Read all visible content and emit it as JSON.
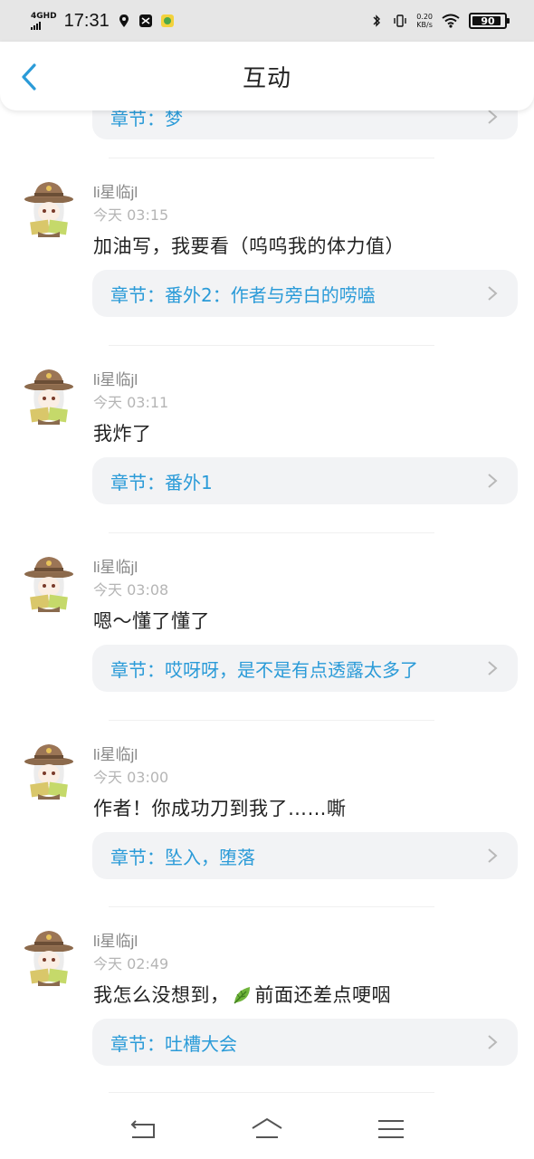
{
  "status_bar": {
    "network": "4GHD",
    "time": "17:31",
    "speed_value": "0.20",
    "speed_unit": "KB/s",
    "battery": "90",
    "battery_level": 0.9
  },
  "header": {
    "title": "互动"
  },
  "partial_chapter": {
    "label": "章节：梦"
  },
  "comments": [
    {
      "username": "li星临jl",
      "time": "今天 03:15",
      "text": "加油写，我要看（呜呜我的体力值）",
      "chapter": "章节：番外2：作者与旁白的唠嗑"
    },
    {
      "username": "li星临jl",
      "time": "今天 03:11",
      "text": "我炸了",
      "chapter": "章节：番外1"
    },
    {
      "username": "li星临jl",
      "time": "今天 03:08",
      "text": "嗯～懂了懂了",
      "chapter": "章节：哎呀呀，是不是有点透露太多了"
    },
    {
      "username": "li星临jl",
      "time": "今天 03:00",
      "text": "作者！你成功刀到我了……嘶",
      "chapter": "章节：坠入，堕落"
    },
    {
      "username": "li星临jl",
      "time": "今天 02:49",
      "text_before": "我怎么没想到，",
      "text_after": "前面还差点哽咽",
      "chapter": "章节：吐槽大会"
    }
  ],
  "colors": {
    "accent": "#2b9bd8",
    "chapter_bg": "#f2f3f5",
    "status_bg": "#e6e6e6"
  },
  "icons": {
    "back": "chevron-left-icon",
    "chapter_arrow": "chevron-right-icon",
    "emoji": "leaf-emoji-icon"
  }
}
